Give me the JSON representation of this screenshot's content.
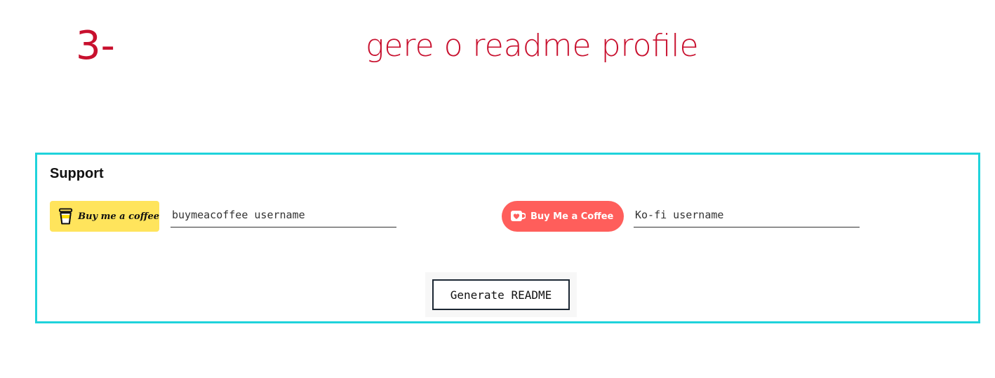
{
  "step": {
    "number": "3-",
    "title": "gere o readme profile"
  },
  "support": {
    "heading": "Support",
    "buymeacoffee": {
      "badge_label": "Buy me a coffee",
      "badge_icon": "coffee-cup-icon",
      "placeholder": "buymeacoffee username",
      "value": ""
    },
    "kofi": {
      "badge_label": "Buy Me a Coffee",
      "badge_icon": "kofi-cup-heart-icon",
      "placeholder": "Ko-fi username",
      "value": ""
    },
    "generate_label": "Generate README"
  },
  "colors": {
    "accent_red": "#c8102e",
    "frame_cyan": "#1fd3db",
    "bmc_yellow": "#ffe45c",
    "kofi_red": "#ff5e5b"
  }
}
